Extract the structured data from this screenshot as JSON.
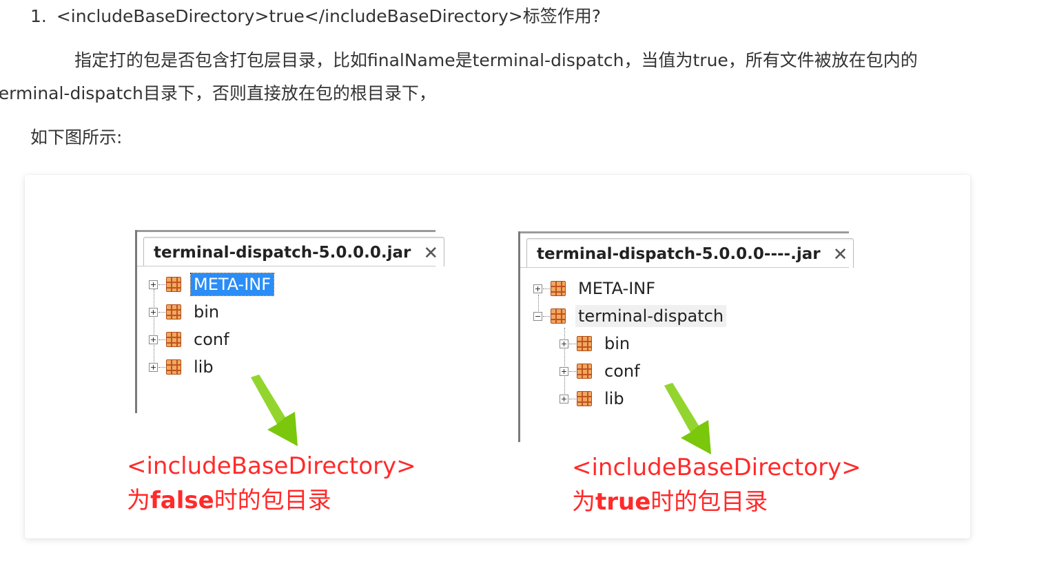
{
  "heading": {
    "number": "1.",
    "text": "<includeBaseDirectory>true</includeBaseDirectory>标签作用?"
  },
  "paragraph": {
    "line1": "指定打的包是否包含打包层目录，比如finalName是terminal-dispatch，当值为true，所有文件被放在包内的",
    "line2": "terminal-dispatch目录下，否则直接放在包的根目录下，"
  },
  "figure_lead": "如下图所示:",
  "figure": {
    "left_panel": {
      "tab_title": "terminal-dispatch-5.0.0.0.jar",
      "close_glyph": "✕",
      "nodes": [
        {
          "label": "META-INF",
          "selected": true
        },
        {
          "label": "bin"
        },
        {
          "label": "conf"
        },
        {
          "label": "lib"
        }
      ],
      "note_line1": "<includeBaseDirectory>",
      "note_line2_prefix": "为",
      "note_line2_bold": "false",
      "note_line2_suffix": "时的包目录"
    },
    "right_panel": {
      "tab_title": "terminal-dispatch-5.0.0.0----.jar",
      "close_glyph": "✕",
      "nodes": [
        {
          "label": "META-INF"
        },
        {
          "label": "terminal-dispatch",
          "expanded": true
        },
        {
          "label": "bin"
        },
        {
          "label": "conf"
        },
        {
          "label": "lib"
        }
      ],
      "note_line1": "<includeBaseDirectory>",
      "note_line2_prefix": "为",
      "note_line2_bold": "true",
      "note_line2_suffix": "时的包目录"
    },
    "colors": {
      "note_red": "#ff2a2a",
      "arrow_green": "#7ac70c",
      "selection_blue": "#2b8df5"
    }
  }
}
